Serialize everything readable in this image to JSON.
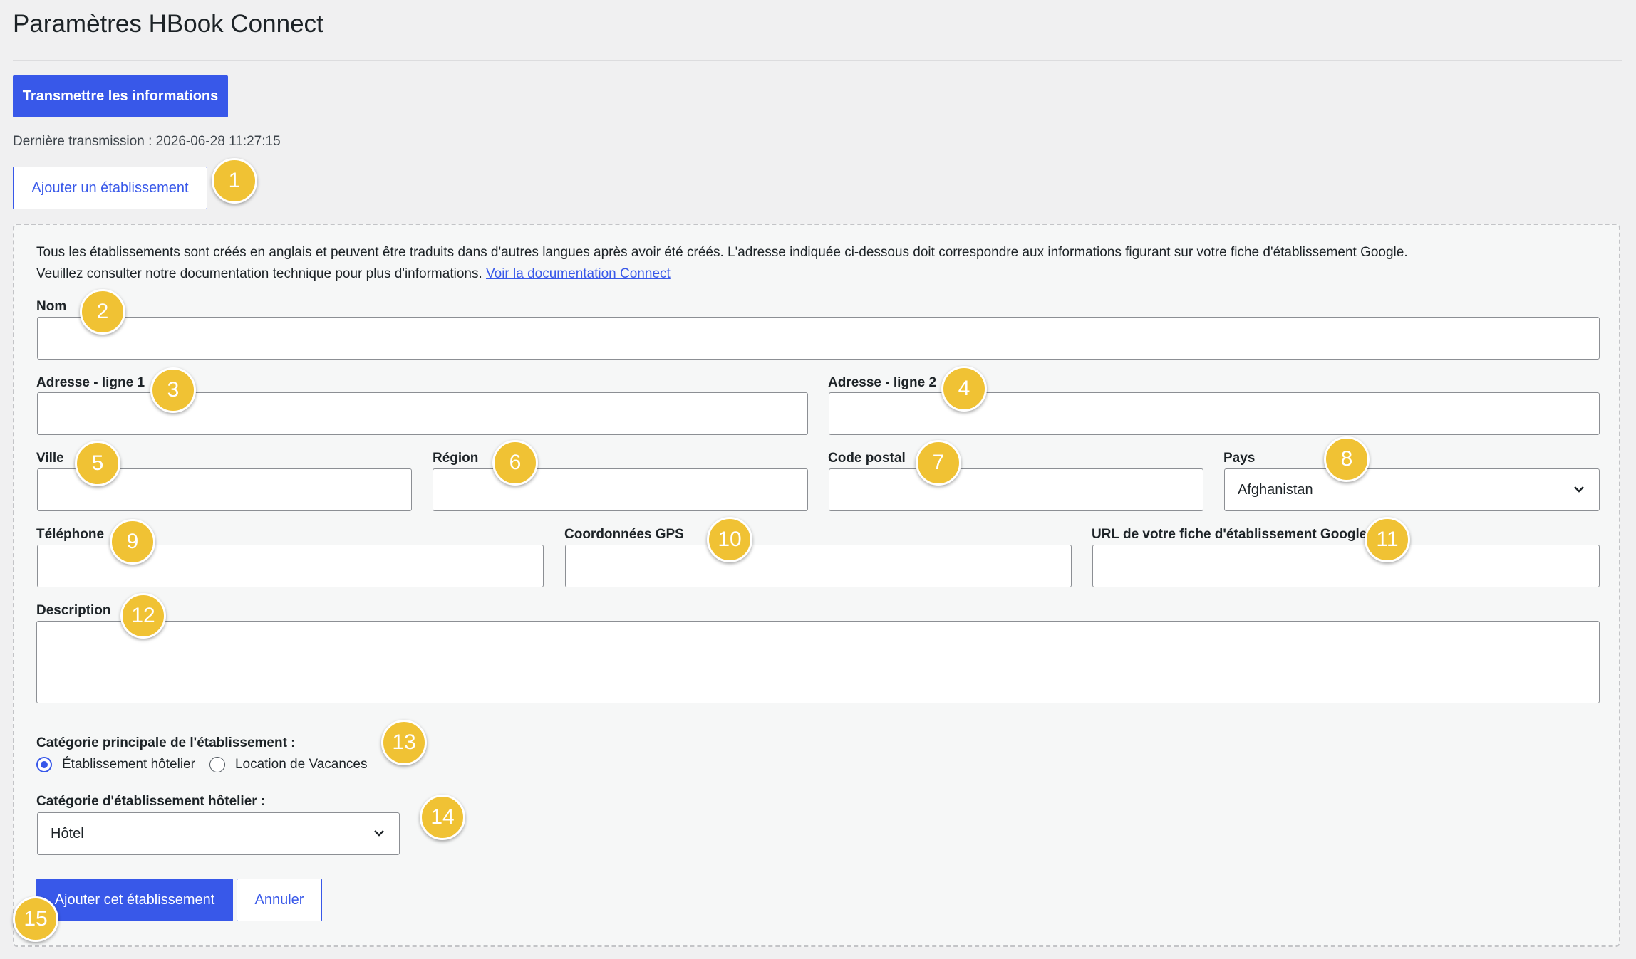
{
  "page": {
    "title": "Paramètres HBook Connect",
    "transmit_button": "Transmettre les informations",
    "last_transmission": "Dernière transmission : 2026-06-28 11:27:15",
    "add_property_button": "Ajouter un établissement"
  },
  "form": {
    "intro_line1": "Tous les établissements sont créés en anglais et peuvent être traduits dans d'autres langues après avoir été créés. L'adresse indiquée ci-dessous doit correspondre aux informations figurant sur votre fiche d'établissement Google.",
    "intro_line2": "Veuillez consulter notre documentation technique pour plus d'informations.",
    "doc_link": "Voir la documentation Connect",
    "name_label": "Nom",
    "address1_label": "Adresse - ligne 1",
    "address2_label": "Adresse - ligne 2",
    "city_label": "Ville",
    "region_label": "Région",
    "postal_label": "Code postal",
    "country_label": "Pays",
    "country_value": "Afghanistan",
    "phone_label": "Téléphone",
    "gps_label": "Coordonnées GPS",
    "google_url_label": "URL de votre fiche d'établissement Google",
    "description_label": "Description",
    "main_category_label": "Catégorie principale de l'établissement :",
    "radio_hotel": "Établissement hôtelier",
    "radio_vacation": "Location de Vacances",
    "hotel_category_label": "Catégorie d'établissement hôtelier :",
    "hotel_category_value": "Hôtel",
    "submit_button": "Ajouter cet établissement",
    "cancel_button": "Annuler"
  },
  "badges": [
    "1",
    "2",
    "3",
    "4",
    "5",
    "6",
    "7",
    "8",
    "9",
    "10",
    "11",
    "12",
    "13",
    "14",
    "15"
  ],
  "colors": {
    "accent": "#3858e9",
    "badge": "#f0c234",
    "background": "#f0f0f1"
  }
}
